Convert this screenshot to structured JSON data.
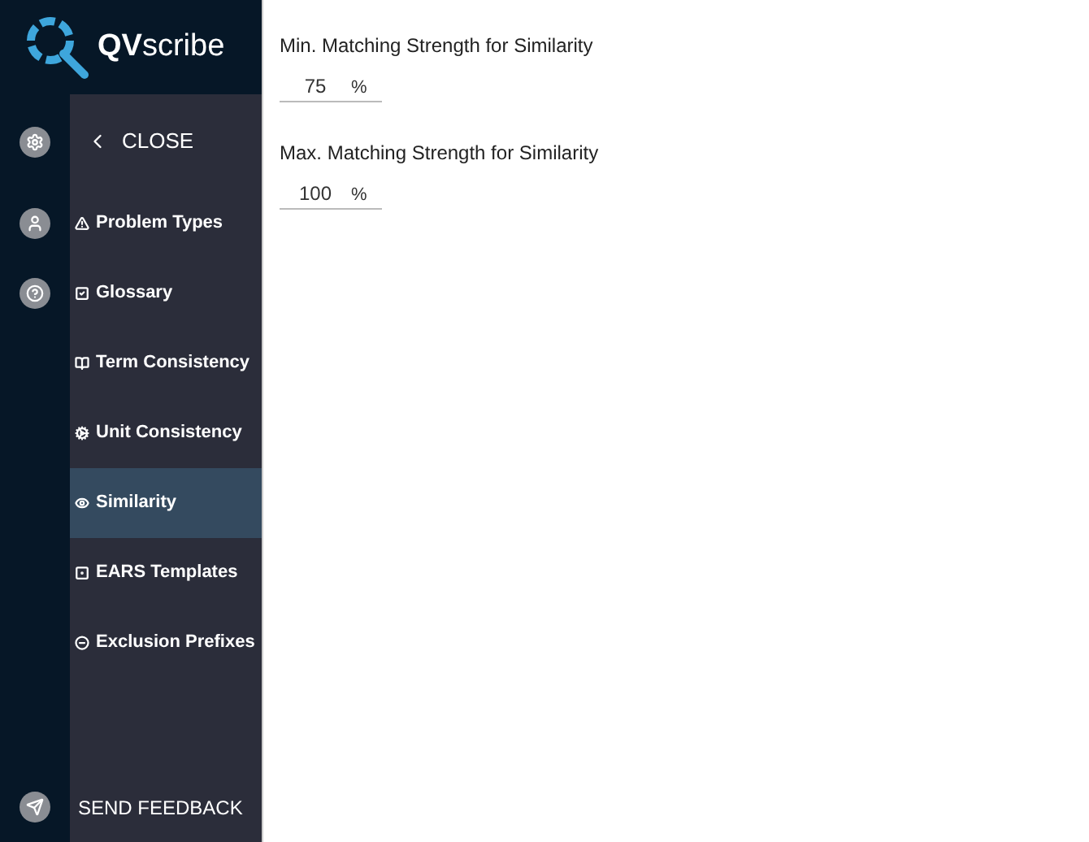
{
  "logo": {
    "text_bold": "QV",
    "text_light": "scribe"
  },
  "close_label": "CLOSE",
  "menu": [
    {
      "label": "Problem Types",
      "selected": false
    },
    {
      "label": "Glossary",
      "selected": false
    },
    {
      "label": "Term Consistency",
      "selected": false
    },
    {
      "label": "Unit Consistency",
      "selected": false
    },
    {
      "label": "Similarity",
      "selected": true
    },
    {
      "label": "EARS Templates",
      "selected": false
    },
    {
      "label": "Exclusion Prefixes",
      "selected": false
    }
  ],
  "feedback_label": "SEND FEEDBACK",
  "settings": [
    {
      "label": "Min. Matching Strength for Similarity",
      "value": "75",
      "unit": "%"
    },
    {
      "label": "Max. Matching Strength for Similarity",
      "value": "100",
      "unit": "%"
    }
  ]
}
